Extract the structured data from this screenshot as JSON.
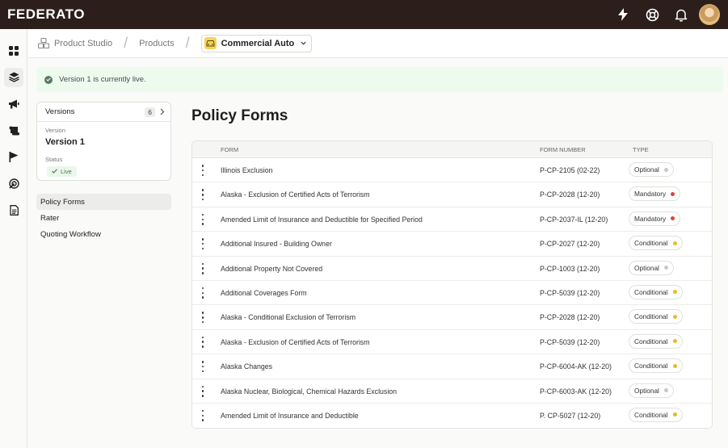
{
  "app": {
    "logo": "FEDERATO"
  },
  "breadcrumb": {
    "items": [
      "Product Studio",
      "Products"
    ],
    "current": "Commercial Auto"
  },
  "banner": {
    "text": "Version 1 is currently live."
  },
  "versions": {
    "header": "Versions",
    "count": "6",
    "version_label": "Version",
    "version_name": "Version 1",
    "status_label": "Status",
    "status_value": "Live"
  },
  "nav": {
    "items": [
      {
        "label": "Policy Forms",
        "active": true
      },
      {
        "label": "Rater",
        "active": false
      },
      {
        "label": "Quoting Workflow",
        "active": false
      }
    ]
  },
  "page": {
    "title": "Policy Forms"
  },
  "table": {
    "columns": {
      "form": "FORM",
      "number": "FORM NUMBER",
      "type": "TYPE"
    },
    "rows": [
      {
        "form": "Illinois Exclusion",
        "number": "P-CP-2105 (02-22)",
        "type": "Optional"
      },
      {
        "form": "Alaska - Exclusion of Certified Acts of Terrorism",
        "number": "P-CP-2028 (12-20)",
        "type": "Mandatory"
      },
      {
        "form": "Amended Limit of Insurance and Deductible for Specified Period",
        "number": "P-CP-2037-IL (12-20)",
        "type": "Mandatory"
      },
      {
        "form": "Additional Insured - Building Owner",
        "number": "P-CP-2027 (12-20)",
        "type": "Conditional"
      },
      {
        "form": "Additional Property Not Covered",
        "number": "P-CP-1003 (12-20)",
        "type": "Optional"
      },
      {
        "form": "Additional Coverages Form",
        "number": "P-CP-5039 (12-20)",
        "type": "Conditional"
      },
      {
        "form": "Alaska - Conditional Exclusion of Terrorism",
        "number": "P-CP-2028 (12-20)",
        "type": "Conditional"
      },
      {
        "form": "Alaska - Exclusion of Certified Acts of Terrorism",
        "number": "P-CP-5039 (12-20)",
        "type": "Conditional"
      },
      {
        "form": "Alaska Changes",
        "number": "P-CP-6004-AK (12-20)",
        "type": "Conditional"
      },
      {
        "form": "Alaska Nuclear, Biological, Chemical Hazards Exclusion",
        "number": "P-CP-6003-AK (12-20)",
        "type": "Optional"
      },
      {
        "form": "Amended Limit of Insurance and Deductible",
        "number": "P. CP-5027 (12-20)",
        "type": "Conditional"
      }
    ]
  },
  "colors": {
    "topbar": "#2b1e1b",
    "optional_dot": "#c8c8c8",
    "mandatory_dot": "#e0443a",
    "conditional_dot": "#e8b92c",
    "banner_bg": "#edfbee"
  },
  "icons": {
    "topbar": [
      "lightning-icon",
      "help-lifebuoy-icon",
      "bell-icon",
      "avatar"
    ],
    "rail": [
      "dashboard-grid-icon",
      "layers-icon",
      "megaphone-icon",
      "scroll-icon",
      "flag-icon",
      "radar-icon",
      "document-icon"
    ]
  }
}
